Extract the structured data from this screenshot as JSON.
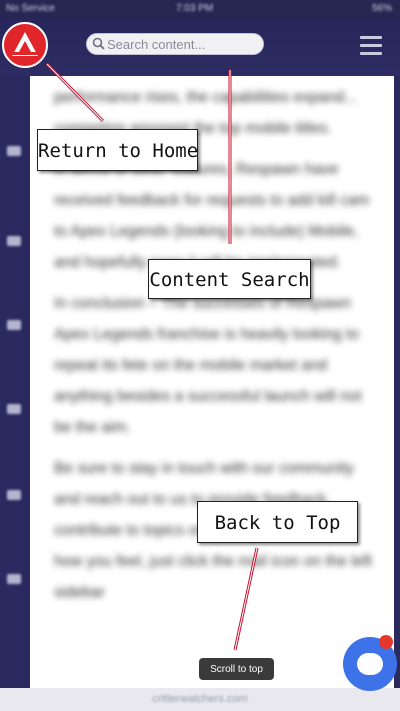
{
  "status_bar": {
    "carrier": "No Service",
    "time": "7:03 PM",
    "battery": "56%"
  },
  "header": {
    "search_placeholder": "Search content...",
    "logo_icon": "apex-logo-icon",
    "menu_icon": "hamburger-menu-icon"
  },
  "article": {
    "paragraphs": [
      "performance rises, the capabilities expand... competing amongst the top mobile titles.",
      "In terms of other features, Respawn have received feedback for requests to add kill cam to Apex Legends (looking to include) Mobile, and hopefully soon it will be implemented.",
      "In conclusion – The successes of Respawn Apex Legends franchise is heavily looking to repeat its fete on the mobile market and anything besides a successful launch will not be the aim.",
      "Be sure to stay in touch with our community and reach out to us to provide feedback, contribute to topics or to simple let us know how you feel, just click the mail icon on the left sidebar"
    ]
  },
  "footer": {
    "domain": "critterwatchers.com"
  },
  "scroll_to_top": {
    "label": "Scroll to top"
  },
  "annotations": {
    "home": "Return to Home",
    "search": "Content Search",
    "top": "Back to Top"
  },
  "colors": {
    "header_bg": "#27265a",
    "logo_red": "#e0262a",
    "chat_blue": "#3d72e8",
    "annotation_line": "#c8102e"
  }
}
